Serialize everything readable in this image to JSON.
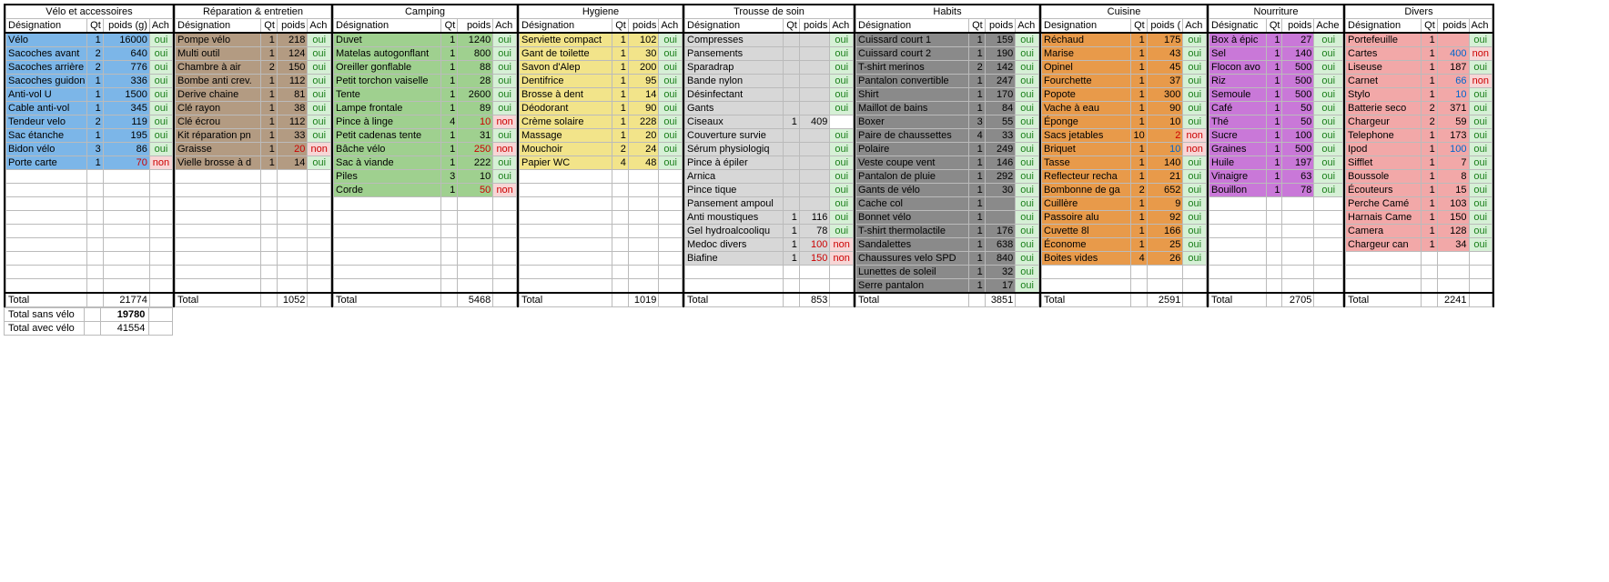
{
  "headers": {
    "des": "Désignation",
    "qt": "Qt",
    "poids": "poids (g)",
    "poids_short": "poids",
    "ach": "Ach",
    "designatic": "Désignatic"
  },
  "footer": {
    "sans_label": "Total sans vélo",
    "sans_val": "19780",
    "avec_label": "Total avec vélo",
    "avec_val": "41554"
  },
  "blocks": [
    {
      "title": "Vélo et accessoires",
      "color": "#7cb6e8",
      "w_des": 88,
      "w_qt": 18,
      "w_p": 54,
      "w_a": 26,
      "poids_hdr": "poids (g)",
      "des_hdr": "Désignation",
      "total": "21774",
      "rows": [
        {
          "d": "Vélo",
          "q": "1",
          "p": "16000",
          "a": "oui"
        },
        {
          "d": "Sacoches avant",
          "q": "2",
          "p": "640",
          "a": "oui"
        },
        {
          "d": "Sacoches arrière",
          "q": "2",
          "p": "776",
          "a": "oui"
        },
        {
          "d": "Sacoches guidon",
          "q": "1",
          "p": "336",
          "a": "oui"
        },
        {
          "d": "Anti-vol U",
          "q": "1",
          "p": "1500",
          "a": "oui"
        },
        {
          "d": "Cable anti-vol",
          "q": "1",
          "p": "345",
          "a": "oui"
        },
        {
          "d": "Tendeur velo",
          "q": "2",
          "p": "119",
          "a": "oui"
        },
        {
          "d": "Sac étanche",
          "q": "1",
          "p": "195",
          "a": "oui"
        },
        {
          "d": "Bidon vélo",
          "q": "3",
          "p": "86",
          "a": "oui"
        },
        {
          "d": "Porte carte",
          "q": "1",
          "p": "70",
          "pcolor": "wred",
          "a": "non"
        }
      ]
    },
    {
      "title": "Réparation & entretien",
      "color": "#b39b82",
      "w_des": 96,
      "w_qt": 18,
      "w_p": 34,
      "w_a": 26,
      "poids_hdr": "poids",
      "des_hdr": "Désignation",
      "total": "1052",
      "rows": [
        {
          "d": "Pompe vélo",
          "q": "1",
          "p": "218",
          "a": "oui"
        },
        {
          "d": "Multi outil",
          "q": "1",
          "p": "124",
          "a": "oui"
        },
        {
          "d": "Chambre à air",
          "q": "2",
          "p": "150",
          "a": "oui"
        },
        {
          "d": "Bombe anti crev.",
          "q": "1",
          "p": "112",
          "a": "oui"
        },
        {
          "d": "Derive chaine",
          "q": "1",
          "p": "81",
          "a": "oui"
        },
        {
          "d": "Clé rayon",
          "q": "1",
          "p": "38",
          "a": "oui"
        },
        {
          "d": "Clé écrou",
          "q": "1",
          "p": "112",
          "a": "oui"
        },
        {
          "d": "Kit réparation pn",
          "q": "1",
          "p": "33",
          "a": "oui"
        },
        {
          "d": "Graisse",
          "q": "1",
          "p": "20",
          "pcolor": "wred",
          "a": "non"
        },
        {
          "d": "Vielle brosse à d",
          "q": "1",
          "p": "14",
          "a": "oui"
        }
      ]
    },
    {
      "title": "Camping",
      "color": "#9fd08f",
      "w_des": 120,
      "w_qt": 18,
      "w_p": 40,
      "w_a": 26,
      "poids_hdr": "poids",
      "des_hdr": "Désignation",
      "total": "5468",
      "rows": [
        {
          "d": "Duvet",
          "q": "1",
          "p": "1240",
          "a": "oui"
        },
        {
          "d": "Matelas autogonflant",
          "q": "1",
          "p": "800",
          "a": "oui"
        },
        {
          "d": "Oreiller gonflable",
          "q": "1",
          "p": "88",
          "a": "oui"
        },
        {
          "d": "Petit torchon vaiselle",
          "q": "1",
          "p": "28",
          "a": "oui"
        },
        {
          "d": "Tente",
          "q": "1",
          "p": "2600",
          "a": "oui"
        },
        {
          "d": "Lampe frontale",
          "q": "1",
          "p": "89",
          "a": "oui"
        },
        {
          "d": "Pince à linge",
          "q": "4",
          "p": "10",
          "pcolor": "wred",
          "a": "non"
        },
        {
          "d": "Petit cadenas tente",
          "q": "1",
          "p": "31",
          "a": "oui"
        },
        {
          "d": "Bâche vélo",
          "q": "1",
          "p": "250",
          "pcolor": "wred",
          "a": "non"
        },
        {
          "d": "Sac à viande",
          "q": "1",
          "p": "222",
          "a": "oui"
        },
        {
          "d": "Piles",
          "q": "3",
          "p": "10",
          "a": "oui"
        },
        {
          "d": "Corde",
          "q": "1",
          "p": "50",
          "pcolor": "wred",
          "a": "non"
        }
      ]
    },
    {
      "title": "Hygiene",
      "color": "#f2e48a",
      "w_des": 104,
      "w_qt": 18,
      "w_p": 34,
      "w_a": 26,
      "poids_hdr": "poids",
      "des_hdr": "Désignation",
      "total": "1019",
      "rows": [
        {
          "d": "Serviette compact",
          "q": "1",
          "p": "102",
          "a": "oui"
        },
        {
          "d": "Gant de toilette",
          "q": "1",
          "p": "30",
          "a": "oui"
        },
        {
          "d": "Savon d'Alep",
          "q": "1",
          "p": "200",
          "a": "oui"
        },
        {
          "d": "Dentifrice",
          "q": "1",
          "p": "95",
          "a": "oui"
        },
        {
          "d": "Brosse à dent",
          "q": "1",
          "p": "14",
          "a": "oui"
        },
        {
          "d": "Déodorant",
          "q": "1",
          "p": "90",
          "a": "oui"
        },
        {
          "d": "Crème solaire",
          "q": "1",
          "p": "228",
          "a": "oui"
        },
        {
          "d": "Massage",
          "q": "1",
          "p": "20",
          "a": "oui"
        },
        {
          "d": "Mouchoir",
          "q": "2",
          "p": "24",
          "a": "oui"
        },
        {
          "d": "Papier WC",
          "q": "4",
          "p": "48",
          "a": "oui"
        }
      ]
    },
    {
      "title": "Trousse de soin",
      "color": "#d7d7d7",
      "w_des": 110,
      "w_qt": 18,
      "w_p": 34,
      "w_a": 26,
      "poids_hdr": "poids",
      "des_hdr": "Désignation",
      "total": "853",
      "rows": [
        {
          "d": "Compresses",
          "q": "",
          "p": "",
          "a": "oui"
        },
        {
          "d": "Pansements",
          "q": "",
          "p": "",
          "a": "oui"
        },
        {
          "d": "Sparadrap",
          "q": "",
          "p": "",
          "a": "oui"
        },
        {
          "d": "Bande nylon",
          "q": "",
          "p": "",
          "a": "oui"
        },
        {
          "d": "Désinfectant",
          "q": "",
          "p": "",
          "a": "oui"
        },
        {
          "d": "Gants",
          "q": "",
          "p": "",
          "a": "oui"
        },
        {
          "d": "Ciseaux",
          "q": "1",
          "p": "409",
          "a": ""
        },
        {
          "d": "Couverture survie",
          "q": "",
          "p": "",
          "a": "oui"
        },
        {
          "d": "Sérum physiologiq",
          "q": "",
          "p": "",
          "a": "oui"
        },
        {
          "d": "Pince à épiler",
          "q": "",
          "p": "",
          "a": "oui"
        },
        {
          "d": "Arnica",
          "q": "",
          "p": "",
          "a": "oui"
        },
        {
          "d": "Pince tique",
          "q": "",
          "p": "",
          "a": "oui"
        },
        {
          "d": "Pansement ampoul",
          "q": "",
          "p": "",
          "a": "oui"
        },
        {
          "d": "Anti moustiques",
          "q": "1",
          "p": "116",
          "a": "oui"
        },
        {
          "d": "Gel hydroalcooliqu",
          "q": "1",
          "p": "78",
          "a": "oui"
        },
        {
          "d": "Medoc divers",
          "q": "1",
          "p": "100",
          "pcolor": "wred",
          "a": "non"
        },
        {
          "d": "Biafine",
          "q": "1",
          "p": "150",
          "pcolor": "wred",
          "a": "non"
        }
      ]
    },
    {
      "title": "Habits",
      "color": "#8a8a8a",
      "w_des": 126,
      "w_qt": 18,
      "w_p": 34,
      "w_a": 26,
      "poids_hdr": "poids",
      "des_hdr": "Désignation",
      "total": "3851",
      "rows": [
        {
          "d": "Cuissard court 1",
          "q": "1",
          "p": "159",
          "a": "oui"
        },
        {
          "d": "Cuissard court 2",
          "q": "1",
          "p": "190",
          "a": "oui"
        },
        {
          "d": "T-shirt merinos",
          "q": "2",
          "p": "142",
          "a": "oui"
        },
        {
          "d": "Pantalon convertible",
          "q": "1",
          "p": "247",
          "a": "oui"
        },
        {
          "d": "Shirt",
          "q": "1",
          "p": "170",
          "a": "oui"
        },
        {
          "d": "Maillot de bains",
          "q": "1",
          "p": "84",
          "a": "oui"
        },
        {
          "d": "Boxer",
          "q": "3",
          "p": "55",
          "a": "oui"
        },
        {
          "d": "Paire de chaussettes",
          "q": "4",
          "p": "33",
          "a": "oui"
        },
        {
          "d": "Polaire",
          "q": "1",
          "p": "249",
          "a": "oui"
        },
        {
          "d": "Veste coupe vent",
          "q": "1",
          "p": "146",
          "a": "oui"
        },
        {
          "d": "Pantalon de pluie",
          "q": "1",
          "p": "292",
          "a": "oui"
        },
        {
          "d": "Gants de vélo",
          "q": "1",
          "p": "30",
          "a": "oui"
        },
        {
          "d": "Cache col",
          "q": "1",
          "p": "",
          "a": "oui"
        },
        {
          "d": "Bonnet vélo",
          "q": "1",
          "p": "",
          "a": "oui"
        },
        {
          "d": "T-shirt thermolactile",
          "q": "1",
          "p": "176",
          "a": "oui"
        },
        {
          "d": "Sandalettes",
          "q": "1",
          "p": "638",
          "a": "oui"
        },
        {
          "d": "Chaussures velo SPD",
          "q": "1",
          "p": "840",
          "a": "oui"
        },
        {
          "d": "Lunettes de soleil",
          "q": "1",
          "p": "32",
          "a": "oui"
        },
        {
          "d": "Serre pantalon",
          "q": "1",
          "p": "17",
          "a": "oui"
        }
      ]
    },
    {
      "title": "Cuisine",
      "color": "#e89a4a",
      "w_des": 100,
      "w_qt": 18,
      "w_p": 40,
      "w_a": 26,
      "poids_hdr": "poids (",
      "des_hdr": "Designation",
      "total": "2591",
      "rows": [
        {
          "d": "Réchaud",
          "q": "1",
          "p": "175",
          "a": "oui"
        },
        {
          "d": "Marise",
          "q": "1",
          "p": "43",
          "a": "oui"
        },
        {
          "d": "Opinel",
          "q": "1",
          "p": "45",
          "a": "oui"
        },
        {
          "d": "Fourchette",
          "q": "1",
          "p": "37",
          "a": "oui"
        },
        {
          "d": "Popote",
          "q": "1",
          "p": "300",
          "a": "oui"
        },
        {
          "d": "Vache à eau",
          "q": "1",
          "p": "90",
          "a": "oui"
        },
        {
          "d": "Éponge",
          "q": "1",
          "p": "10",
          "a": "oui"
        },
        {
          "d": "Sacs jetables",
          "q": "10",
          "p": "2",
          "pcolor": "wred",
          "a": "non"
        },
        {
          "d": "Briquet",
          "q": "1",
          "p": "10",
          "pcolor": "wblue",
          "a": "non"
        },
        {
          "d": "Tasse",
          "q": "1",
          "p": "140",
          "a": "oui"
        },
        {
          "d": "Reflecteur recha",
          "q": "1",
          "p": "21",
          "a": "oui"
        },
        {
          "d": "Bombonne de ga",
          "q": "2",
          "p": "652",
          "a": "oui"
        },
        {
          "d": "Cuillère",
          "q": "1",
          "p": "9",
          "a": "oui"
        },
        {
          "d": "Passoire alu",
          "q": "1",
          "p": "92",
          "a": "oui"
        },
        {
          "d": "Cuvette 8l",
          "q": "1",
          "p": "166",
          "a": "oui"
        },
        {
          "d": "Économe",
          "q": "1",
          "p": "25",
          "a": "oui"
        },
        {
          "d": "Boites vides",
          "q": "4",
          "p": "26",
          "a": "oui"
        }
      ]
    },
    {
      "title": "Nourriture",
      "color": "#c978d8",
      "w_des": 64,
      "w_qt": 18,
      "w_p": 36,
      "w_a": 32,
      "poids_hdr": "poids",
      "des_hdr": "Désignatic",
      "ach_hdr": "Ache",
      "total": "2705",
      "rows": [
        {
          "d": "Box à épic",
          "q": "1",
          "p": "27",
          "a": "oui"
        },
        {
          "d": "Sel",
          "q": "1",
          "p": "140",
          "a": "oui"
        },
        {
          "d": "Flocon avo",
          "q": "1",
          "p": "500",
          "a": "oui"
        },
        {
          "d": "Riz",
          "q": "1",
          "p": "500",
          "a": "oui"
        },
        {
          "d": "Semoule",
          "q": "1",
          "p": "500",
          "a": "oui"
        },
        {
          "d": "Café",
          "q": "1",
          "p": "50",
          "a": "oui"
        },
        {
          "d": "Thé",
          "q": "1",
          "p": "50",
          "a": "oui"
        },
        {
          "d": "Sucre",
          "q": "1",
          "p": "100",
          "a": "oui"
        },
        {
          "d": "Graines",
          "q": "1",
          "p": "500",
          "a": "oui"
        },
        {
          "d": "Huile",
          "q": "1",
          "p": "197",
          "a": "oui"
        },
        {
          "d": "Vinaigre",
          "q": "1",
          "p": "63",
          "a": "oui"
        },
        {
          "d": "Bouillon",
          "q": "1",
          "p": "78",
          "a": "oui"
        }
      ]
    },
    {
      "title": "Divers",
      "color": "#f2a8a8",
      "w_des": 86,
      "w_qt": 18,
      "w_p": 36,
      "w_a": 26,
      "poids_hdr": "poids",
      "des_hdr": "Désignation",
      "total": "2241",
      "rows": [
        {
          "d": "Portefeuille",
          "q": "1",
          "p": "",
          "a": "oui"
        },
        {
          "d": "Cartes",
          "q": "1",
          "p": "400",
          "pcolor": "wblue",
          "a": "non"
        },
        {
          "d": "Liseuse",
          "q": "1",
          "p": "187",
          "a": "oui"
        },
        {
          "d": "Carnet",
          "q": "1",
          "p": "66",
          "pcolor": "wblue",
          "a": "non"
        },
        {
          "d": "Stylo",
          "q": "1",
          "p": "10",
          "pcolor": "wblue",
          "a": "oui"
        },
        {
          "d": "Batterie seco",
          "q": "2",
          "p": "371",
          "a": "oui"
        },
        {
          "d": "Chargeur",
          "q": "2",
          "p": "59",
          "a": "oui"
        },
        {
          "d": "Telephone",
          "q": "1",
          "p": "173",
          "a": "oui"
        },
        {
          "d": "Ipod",
          "q": "1",
          "p": "100",
          "pcolor": "wblue",
          "a": "oui"
        },
        {
          "d": "Sifflet",
          "q": "1",
          "p": "7",
          "a": "oui"
        },
        {
          "d": "Boussole",
          "q": "1",
          "p": "8",
          "a": "oui"
        },
        {
          "d": "Écouteurs",
          "q": "1",
          "p": "15",
          "a": "oui"
        },
        {
          "d": "Perche Camé",
          "q": "1",
          "p": "103",
          "a": "oui"
        },
        {
          "d": "Harnais Came",
          "q": "1",
          "p": "150",
          "a": "oui"
        },
        {
          "d": "Camera",
          "q": "1",
          "p": "128",
          "a": "oui"
        },
        {
          "d": "Chargeur can",
          "q": "1",
          "p": "34",
          "a": "oui"
        }
      ]
    }
  ]
}
